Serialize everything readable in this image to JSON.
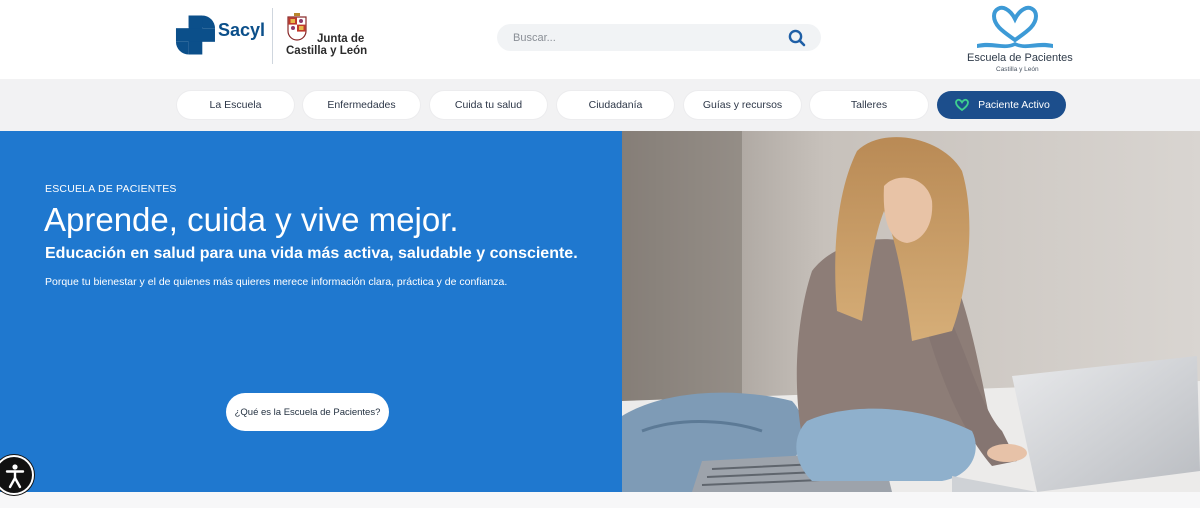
{
  "header": {
    "sacyl_logo_text": "Sacyl",
    "junta_logo_line1": "Junta de",
    "junta_logo_line2": "Castilla y León",
    "search_placeholder": "Buscar...",
    "escuela_logo_title": "Escuela de Pacientes",
    "escuela_logo_subtitle": "Castilla y León"
  },
  "nav": {
    "items": [
      {
        "label": "La Escuela"
      },
      {
        "label": "Enfermedades"
      },
      {
        "label": "Cuida tu salud"
      },
      {
        "label": "Ciudadanía"
      },
      {
        "label": "Guías y recursos"
      },
      {
        "label": "Talleres"
      },
      {
        "label": "Paciente Activo",
        "active": true
      }
    ]
  },
  "hero": {
    "eyebrow": "ESCUELA DE PACIENTES",
    "title": "Aprende, cuida y vive mejor.",
    "subtitle": "Educación en salud para una vida más activa, saludable y consciente.",
    "text": "Porque tu bienestar y el de quienes más quieres merece información clara, práctica y de confianza.",
    "button_label": "¿Qué es la Escuela de Pacientes?"
  },
  "colors": {
    "hero_blue": "#1f78cf",
    "nav_active": "#1c4e8c",
    "brand_dark_blue": "#0b4f8a",
    "accessibility_button": "#111111"
  },
  "icons": {
    "search": "search-icon",
    "accessibility": "accessibility-icon",
    "paciente_activo": "heart-icon"
  }
}
